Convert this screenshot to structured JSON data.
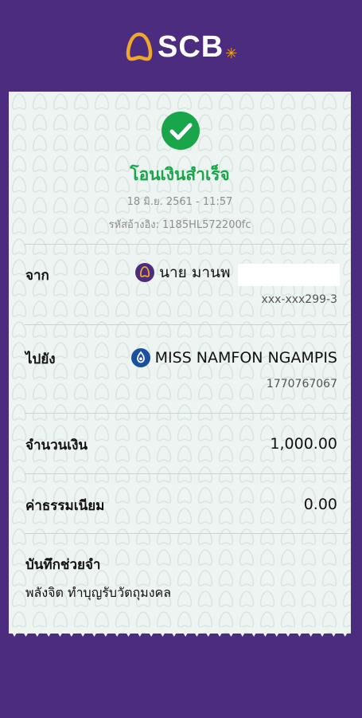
{
  "brand": {
    "name": "SCB",
    "star": "✳",
    "colors": {
      "background": "#4c2c7e",
      "gold": "#f0a82a",
      "success": "#19a64a",
      "receipt": "#eef4f1"
    }
  },
  "receipt": {
    "status": "โอนเงินสำเร็จ",
    "status_icon": "check-circle-icon",
    "datetime": "18 มิ.ย. 2561 - 11:57",
    "ref_label": "รหัสอ้างอิง:",
    "ref_code": "1185HL572200fc",
    "from": {
      "label": "จาก",
      "bank_icon": "scb-bank-icon",
      "name": "นาย มานพ",
      "account": "xxx-xxx299-3"
    },
    "to": {
      "label": "ไปยัง",
      "bank_icon": "ktb-bank-icon",
      "name": "MISS NAMFON NGAMPIS",
      "account": "1770767067"
    },
    "amount": {
      "label": "จำนวนเงิน",
      "value": "1,000.00"
    },
    "fee": {
      "label": "ค่าธรรมเนียม",
      "value": "0.00"
    },
    "memo": {
      "label": "บันทึกช่วยจำ",
      "text": "พลังจิต ทำบุญรับวัตถุมงคล"
    }
  }
}
